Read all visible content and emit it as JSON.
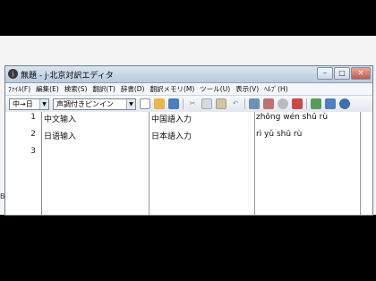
{
  "window": {
    "title": "無題 - j·北京対訳エディタ",
    "app_icon": "app-icon",
    "controls": [
      "minimize-icon",
      "maximize-icon",
      "close-icon"
    ]
  },
  "menu": [
    {
      "label": "ﾌｧｲﾙ(F)"
    },
    {
      "label": "編集(E)"
    },
    {
      "label": "検索(S)"
    },
    {
      "label": "翻訳(T)"
    },
    {
      "label": "辞書(D)"
    },
    {
      "label": "翻訳メモリ(M)"
    },
    {
      "label": "ツール(U)"
    },
    {
      "label": "表示(V)"
    },
    {
      "label": "ﾍﾙﾌﾟ(H)"
    }
  ],
  "toolbar": {
    "direction_select": "中→日",
    "reading_select": "声調付きピンイン",
    "icons": [
      "new-document-icon",
      "open-folder-icon",
      "save-icon",
      "cut-icon",
      "copy-icon",
      "paste-icon",
      "undo-icon",
      "translate-icon",
      "dictionary-icon",
      "settings-icon",
      "check-icon",
      "memory-icon",
      "compare-icon",
      "speaker-icon"
    ]
  },
  "rows": [
    {
      "num": "1",
      "chinese": "中文输入",
      "japanese": "中国語入力",
      "pinyin": "zhōng wén shū rù"
    },
    {
      "num": "2",
      "chinese": "日语输入",
      "japanese": "日本語入力",
      "pinyin": "rì yǔ shū rù"
    },
    {
      "num": "3",
      "chinese": "",
      "japanese": "",
      "pinyin": ""
    }
  ],
  "colors": {
    "titlebar": "#c6d5e6",
    "grid_background": "#ffffff",
    "border": "#8c8c8c"
  }
}
